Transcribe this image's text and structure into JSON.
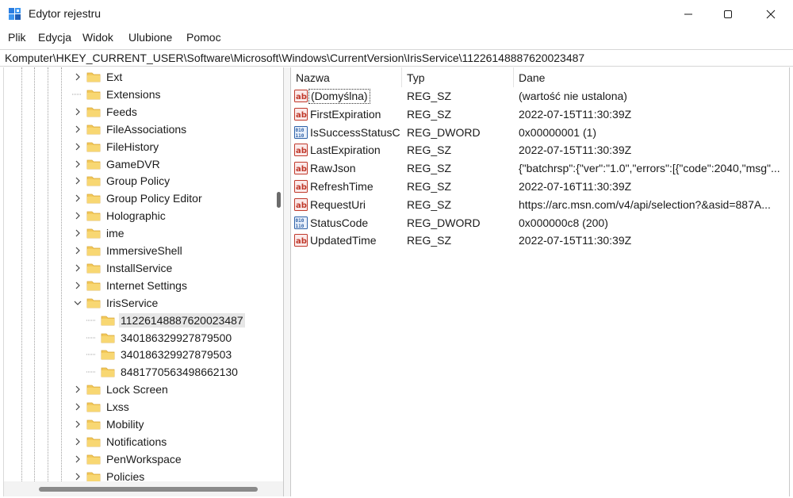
{
  "window": {
    "title": "Edytor rejestru"
  },
  "menu": {
    "items": [
      "Plik",
      "Edycja",
      "Widok",
      "Ulubione",
      "Pomoc"
    ]
  },
  "address": {
    "path": "Komputer\\HKEY_CURRENT_USER\\Software\\Microsoft\\Windows\\CurrentVersion\\IrisService\\11226148887620023487"
  },
  "tree": {
    "items": [
      {
        "label": "Ext",
        "expand": "collapsed",
        "level": 1
      },
      {
        "label": "Extensions",
        "expand": "none",
        "level": 1
      },
      {
        "label": "Feeds",
        "expand": "collapsed",
        "level": 1
      },
      {
        "label": "FileAssociations",
        "expand": "collapsed",
        "level": 1
      },
      {
        "label": "FileHistory",
        "expand": "collapsed",
        "level": 1
      },
      {
        "label": "GameDVR",
        "expand": "collapsed",
        "level": 1
      },
      {
        "label": "Group Policy",
        "expand": "collapsed",
        "level": 1
      },
      {
        "label": "Group Policy Editor",
        "expand": "collapsed",
        "level": 1
      },
      {
        "label": "Holographic",
        "expand": "collapsed",
        "level": 1
      },
      {
        "label": "ime",
        "expand": "collapsed",
        "level": 1
      },
      {
        "label": "ImmersiveShell",
        "expand": "collapsed",
        "level": 1
      },
      {
        "label": "InstallService",
        "expand": "collapsed",
        "level": 1
      },
      {
        "label": "Internet Settings",
        "expand": "collapsed",
        "level": 1
      },
      {
        "label": "IrisService",
        "expand": "expanded",
        "level": 1
      },
      {
        "label": "11226148887620023487",
        "expand": "none",
        "level": 2,
        "selected": true
      },
      {
        "label": "340186329927879500",
        "expand": "none",
        "level": 2
      },
      {
        "label": "340186329927879503",
        "expand": "none",
        "level": 2
      },
      {
        "label": "8481770563498662130",
        "expand": "none",
        "level": 2
      },
      {
        "label": "Lock Screen",
        "expand": "collapsed",
        "level": 1
      },
      {
        "label": "Lxss",
        "expand": "collapsed",
        "level": 1
      },
      {
        "label": "Mobility",
        "expand": "collapsed",
        "level": 1
      },
      {
        "label": "Notifications",
        "expand": "collapsed",
        "level": 1
      },
      {
        "label": "PenWorkspace",
        "expand": "collapsed",
        "level": 1
      },
      {
        "label": "Policies",
        "expand": "collapsed",
        "level": 1
      }
    ]
  },
  "values": {
    "columns": {
      "name": "Nazwa",
      "type": "Typ",
      "data": "Dane"
    },
    "rows": [
      {
        "icon": "string-value-icon",
        "name": "(Domyślna)",
        "type": "REG_SZ",
        "data": "(wartość nie ustalona)",
        "focused": true
      },
      {
        "icon": "string-value-icon",
        "name": "FirstExpiration",
        "type": "REG_SZ",
        "data": "2022-07-15T11:30:39Z"
      },
      {
        "icon": "binary-value-icon",
        "name": "IsSuccessStatusC...",
        "type": "REG_DWORD",
        "data": "0x00000001 (1)"
      },
      {
        "icon": "string-value-icon",
        "name": "LastExpiration",
        "type": "REG_SZ",
        "data": "2022-07-15T11:30:39Z"
      },
      {
        "icon": "string-value-icon",
        "name": "RawJson",
        "type": "REG_SZ",
        "data": "{\"batchrsp\":{\"ver\":\"1.0\",\"errors\":[{\"code\":2040,\"msg\"..."
      },
      {
        "icon": "string-value-icon",
        "name": "RefreshTime",
        "type": "REG_SZ",
        "data": "2022-07-16T11:30:39Z"
      },
      {
        "icon": "string-value-icon",
        "name": "RequestUri",
        "type": "REG_SZ",
        "data": "https://arc.msn.com/v4/api/selection?&asid=887A..."
      },
      {
        "icon": "binary-value-icon",
        "name": "StatusCode",
        "type": "REG_DWORD",
        "data": "0x000000c8 (200)"
      },
      {
        "icon": "string-value-icon",
        "name": "UpdatedTime",
        "type": "REG_SZ",
        "data": "2022-07-15T11:30:39Z"
      }
    ]
  },
  "colors": {
    "folder": "#f3c95a",
    "selection": "#e6e6e6",
    "string_icon": "#c0392b",
    "binary_icon": "#2f62a8"
  }
}
